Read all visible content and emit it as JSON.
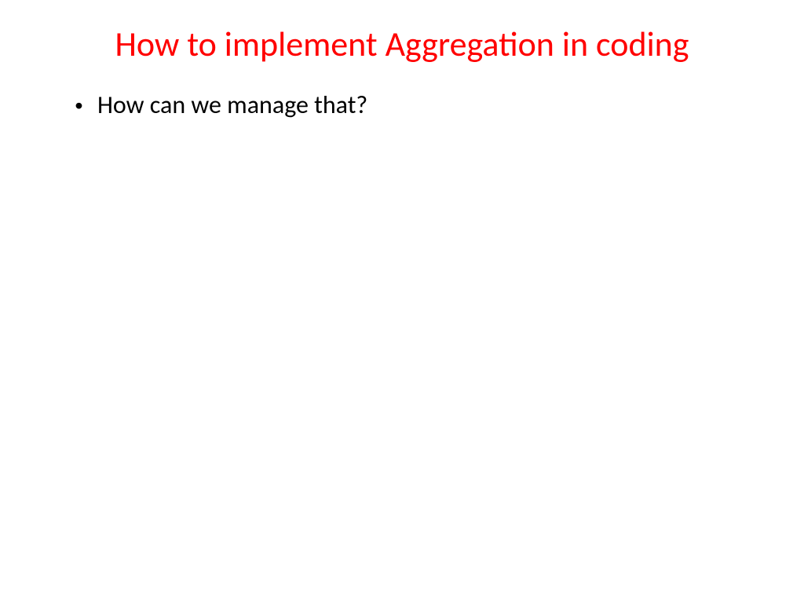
{
  "slide": {
    "title": "How to implement Aggregation in coding",
    "bullets": [
      "How can we manage that?"
    ]
  }
}
